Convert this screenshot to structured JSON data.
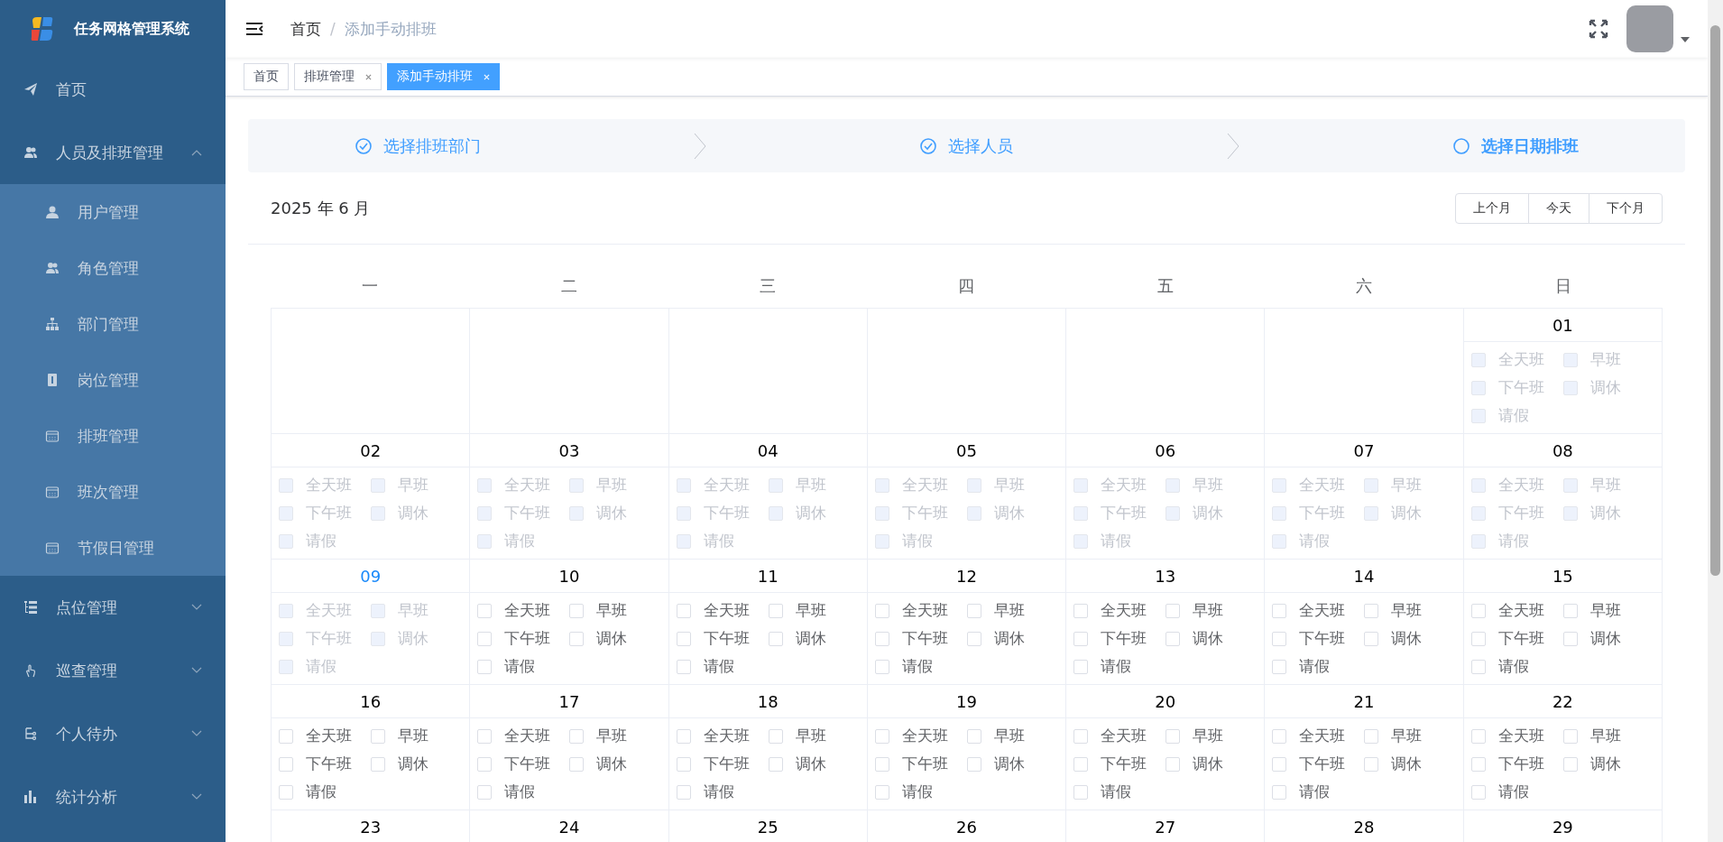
{
  "app": {
    "title": "任务网格管理系统"
  },
  "sidebar": {
    "items": [
      {
        "label": "首页",
        "selected": false
      },
      {
        "label": "人员及排班管理",
        "expanded": true,
        "selected": false,
        "children": [
          {
            "label": "用户管理",
            "selected": false
          },
          {
            "label": "角色管理",
            "selected": false
          },
          {
            "label": "部门管理",
            "selected": false
          },
          {
            "label": "岗位管理",
            "selected": false
          },
          {
            "label": "排班管理",
            "selected": false
          },
          {
            "label": "班次管理",
            "selected": false
          },
          {
            "label": "节假日管理",
            "selected": false
          }
        ]
      },
      {
        "label": "点位管理",
        "expanded": false,
        "selected": false
      },
      {
        "label": "巡查管理",
        "expanded": false,
        "selected": false
      },
      {
        "label": "个人待办",
        "expanded": false,
        "selected": false
      },
      {
        "label": "统计分析",
        "expanded": false,
        "selected": false
      }
    ]
  },
  "breadcrumb": {
    "separator": "/",
    "items": [
      "首页",
      "添加手动排班"
    ]
  },
  "tabs": [
    {
      "label": "首页",
      "closable": false,
      "selected": false
    },
    {
      "label": "排班管理",
      "closable": true,
      "selected": false
    },
    {
      "label": "添加手动排班",
      "closable": true,
      "selected": true
    }
  ],
  "steps": [
    {
      "label": "选择排班部门",
      "completed": true,
      "selected": false
    },
    {
      "label": "选择人员",
      "completed": true,
      "selected": false
    },
    {
      "label": "选择日期排班",
      "completed": false,
      "selected": true
    }
  ],
  "calendar": {
    "title": "2025 年 6 月",
    "buttons": [
      "上个月",
      "今天",
      "下个月"
    ],
    "weekdays": [
      "一",
      "二",
      "三",
      "四",
      "五",
      "六",
      "日"
    ],
    "weeks": [
      [
        {
          "day": "01",
          "disabled": true,
          "today": false,
          "options": [
            {
              "label": "全天班",
              "checked": false
            },
            {
              "label": "早班",
              "checked": false
            },
            {
              "label": "下午班",
              "checked": false
            },
            {
              "label": "调休",
              "checked": false
            },
            {
              "label": "请假",
              "checked": false
            }
          ]
        }
      ],
      [
        {
          "day": "02",
          "disabled": true,
          "today": false,
          "options": [
            {
              "label": "全天班",
              "checked": false
            },
            {
              "label": "早班",
              "checked": false
            },
            {
              "label": "下午班",
              "checked": false
            },
            {
              "label": "调休",
              "checked": false
            },
            {
              "label": "请假",
              "checked": false
            }
          ]
        },
        {
          "day": "03",
          "disabled": true,
          "today": false,
          "options": [
            {
              "label": "全天班",
              "checked": false
            },
            {
              "label": "早班",
              "checked": false
            },
            {
              "label": "下午班",
              "checked": false
            },
            {
              "label": "调休",
              "checked": false
            },
            {
              "label": "请假",
              "checked": false
            }
          ]
        },
        {
          "day": "04",
          "disabled": true,
          "today": false,
          "options": [
            {
              "label": "全天班",
              "checked": false
            },
            {
              "label": "早班",
              "checked": false
            },
            {
              "label": "下午班",
              "checked": false
            },
            {
              "label": "调休",
              "checked": false
            },
            {
              "label": "请假",
              "checked": false
            }
          ]
        },
        {
          "day": "05",
          "disabled": true,
          "today": false,
          "options": [
            {
              "label": "全天班",
              "checked": false
            },
            {
              "label": "早班",
              "checked": false
            },
            {
              "label": "下午班",
              "checked": false
            },
            {
              "label": "调休",
              "checked": false
            },
            {
              "label": "请假",
              "checked": false
            }
          ]
        },
        {
          "day": "06",
          "disabled": true,
          "today": false,
          "options": [
            {
              "label": "全天班",
              "checked": false
            },
            {
              "label": "早班",
              "checked": false
            },
            {
              "label": "下午班",
              "checked": false
            },
            {
              "label": "调休",
              "checked": false
            },
            {
              "label": "请假",
              "checked": false
            }
          ]
        },
        {
          "day": "07",
          "disabled": true,
          "today": false,
          "options": [
            {
              "label": "全天班",
              "checked": false
            },
            {
              "label": "早班",
              "checked": false
            },
            {
              "label": "下午班",
              "checked": false
            },
            {
              "label": "调休",
              "checked": false
            },
            {
              "label": "请假",
              "checked": false
            }
          ]
        },
        {
          "day": "08",
          "disabled": true,
          "today": false,
          "options": [
            {
              "label": "全天班",
              "checked": false
            },
            {
              "label": "早班",
              "checked": false
            },
            {
              "label": "下午班",
              "checked": false
            },
            {
              "label": "调休",
              "checked": false
            },
            {
              "label": "请假",
              "checked": false
            }
          ]
        }
      ],
      [
        {
          "day": "09",
          "disabled": true,
          "today": true,
          "options": [
            {
              "label": "全天班",
              "checked": false
            },
            {
              "label": "早班",
              "checked": false
            },
            {
              "label": "下午班",
              "checked": false
            },
            {
              "label": "调休",
              "checked": false
            },
            {
              "label": "请假",
              "checked": false
            }
          ]
        },
        {
          "day": "10",
          "disabled": false,
          "today": false,
          "options": [
            {
              "label": "全天班",
              "checked": false
            },
            {
              "label": "早班",
              "checked": false
            },
            {
              "label": "下午班",
              "checked": false
            },
            {
              "label": "调休",
              "checked": false
            },
            {
              "label": "请假",
              "checked": false
            }
          ]
        },
        {
          "day": "11",
          "disabled": false,
          "today": false,
          "options": [
            {
              "label": "全天班",
              "checked": false
            },
            {
              "label": "早班",
              "checked": false
            },
            {
              "label": "下午班",
              "checked": false
            },
            {
              "label": "调休",
              "checked": false
            },
            {
              "label": "请假",
              "checked": false
            }
          ]
        },
        {
          "day": "12",
          "disabled": false,
          "today": false,
          "options": [
            {
              "label": "全天班",
              "checked": false
            },
            {
              "label": "早班",
              "checked": false
            },
            {
              "label": "下午班",
              "checked": false
            },
            {
              "label": "调休",
              "checked": false
            },
            {
              "label": "请假",
              "checked": false
            }
          ]
        },
        {
          "day": "13",
          "disabled": false,
          "today": false,
          "options": [
            {
              "label": "全天班",
              "checked": false
            },
            {
              "label": "早班",
              "checked": false
            },
            {
              "label": "下午班",
              "checked": false
            },
            {
              "label": "调休",
              "checked": false
            },
            {
              "label": "请假",
              "checked": false
            }
          ]
        },
        {
          "day": "14",
          "disabled": false,
          "today": false,
          "options": [
            {
              "label": "全天班",
              "checked": false
            },
            {
              "label": "早班",
              "checked": false
            },
            {
              "label": "下午班",
              "checked": false
            },
            {
              "label": "调休",
              "checked": false
            },
            {
              "label": "请假",
              "checked": false
            }
          ]
        },
        {
          "day": "15",
          "disabled": false,
          "today": false,
          "options": [
            {
              "label": "全天班",
              "checked": false
            },
            {
              "label": "早班",
              "checked": false
            },
            {
              "label": "下午班",
              "checked": false
            },
            {
              "label": "调休",
              "checked": false
            },
            {
              "label": "请假",
              "checked": false
            }
          ]
        }
      ],
      [
        {
          "day": "16",
          "disabled": false,
          "today": false,
          "options": [
            {
              "label": "全天班",
              "checked": false
            },
            {
              "label": "早班",
              "checked": false
            },
            {
              "label": "下午班",
              "checked": false
            },
            {
              "label": "调休",
              "checked": false
            },
            {
              "label": "请假",
              "checked": false
            }
          ]
        },
        {
          "day": "17",
          "disabled": false,
          "today": false,
          "options": [
            {
              "label": "全天班",
              "checked": false
            },
            {
              "label": "早班",
              "checked": false
            },
            {
              "label": "下午班",
              "checked": false
            },
            {
              "label": "调休",
              "checked": false
            },
            {
              "label": "请假",
              "checked": false
            }
          ]
        },
        {
          "day": "18",
          "disabled": false,
          "today": false,
          "options": [
            {
              "label": "全天班",
              "checked": false
            },
            {
              "label": "早班",
              "checked": false
            },
            {
              "label": "下午班",
              "checked": false
            },
            {
              "label": "调休",
              "checked": false
            },
            {
              "label": "请假",
              "checked": false
            }
          ]
        },
        {
          "day": "19",
          "disabled": false,
          "today": false,
          "options": [
            {
              "label": "全天班",
              "checked": false
            },
            {
              "label": "早班",
              "checked": false
            },
            {
              "label": "下午班",
              "checked": false
            },
            {
              "label": "调休",
              "checked": false
            },
            {
              "label": "请假",
              "checked": false
            }
          ]
        },
        {
          "day": "20",
          "disabled": false,
          "today": false,
          "options": [
            {
              "label": "全天班",
              "checked": false
            },
            {
              "label": "早班",
              "checked": false
            },
            {
              "label": "下午班",
              "checked": false
            },
            {
              "label": "调休",
              "checked": false
            },
            {
              "label": "请假",
              "checked": false
            }
          ]
        },
        {
          "day": "21",
          "disabled": false,
          "today": false,
          "options": [
            {
              "label": "全天班",
              "checked": false
            },
            {
              "label": "早班",
              "checked": false
            },
            {
              "label": "下午班",
              "checked": false
            },
            {
              "label": "调休",
              "checked": false
            },
            {
              "label": "请假",
              "checked": false
            }
          ]
        },
        {
          "day": "22",
          "disabled": false,
          "today": false,
          "options": [
            {
              "label": "全天班",
              "checked": false
            },
            {
              "label": "早班",
              "checked": false
            },
            {
              "label": "下午班",
              "checked": false
            },
            {
              "label": "调休",
              "checked": false
            },
            {
              "label": "请假",
              "checked": false
            }
          ]
        }
      ],
      [
        {
          "day": "23",
          "today": false
        },
        {
          "day": "24",
          "today": false
        },
        {
          "day": "25",
          "today": false
        },
        {
          "day": "26",
          "today": false
        },
        {
          "day": "27",
          "today": false
        },
        {
          "day": "28",
          "today": false
        },
        {
          "day": "29",
          "today": false
        }
      ]
    ]
  }
}
